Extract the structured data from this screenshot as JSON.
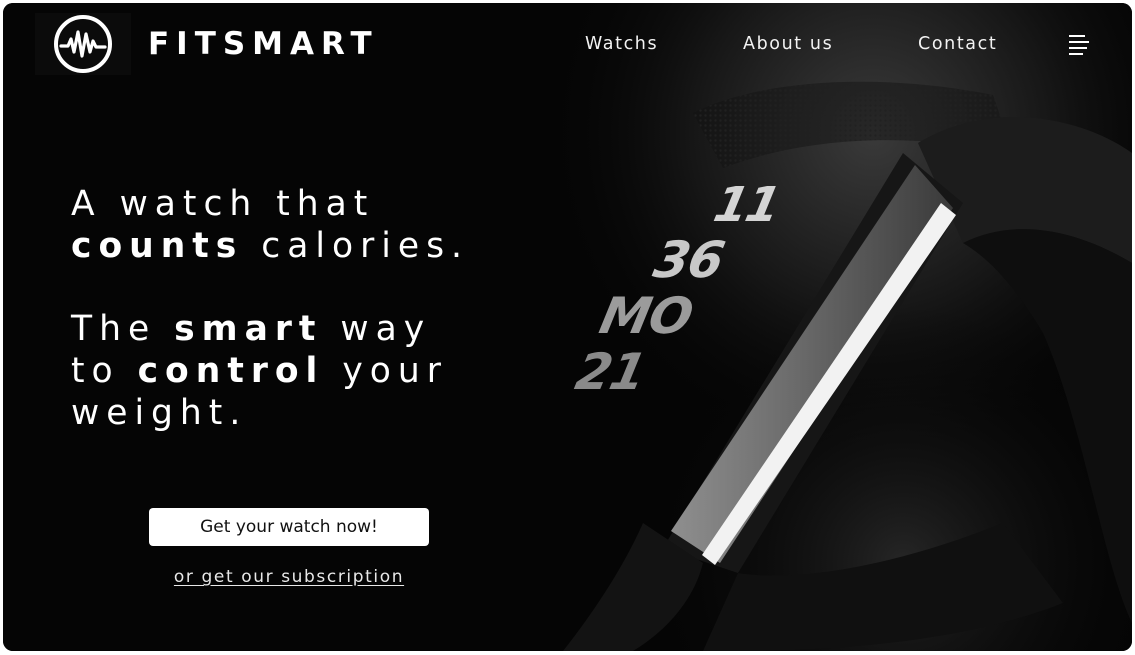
{
  "header": {
    "brand": "FITSMART",
    "nav": {
      "watches": "Watchs",
      "about": "About us",
      "contact": "Contact"
    }
  },
  "hero": {
    "line1": "A watch that",
    "line2_bold": "counts",
    "line2_rest": " calories.",
    "line3_a": "The ",
    "line3_bold": "smart",
    "line3_b": " way",
    "line4_a": "to ",
    "line4_bold": "control",
    "line4_b": " your",
    "line5": "weight.",
    "watch_display": {
      "hour": "11",
      "minute": "36",
      "day": "MO",
      "date": "21"
    }
  },
  "cta": {
    "button_label": "Get your watch now!",
    "subscription_link": "or get our subscription"
  },
  "icons": {
    "logo": "heartbeat-circle-logo",
    "menu": "hamburger-menu-icon"
  },
  "colors": {
    "background": "#050505",
    "text": "#ffffff",
    "button_bg": "#ffffff",
    "button_text": "#111111"
  }
}
